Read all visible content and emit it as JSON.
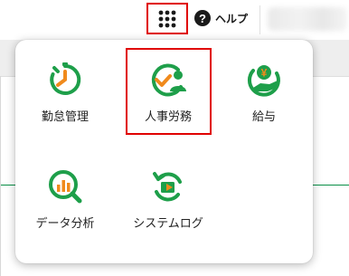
{
  "header": {
    "help_label": "ヘルプ",
    "help_glyph": "?"
  },
  "apps_menu": {
    "items": [
      {
        "label": "勤怠管理",
        "icon": "stopwatch-icon"
      },
      {
        "label": "人事労務",
        "icon": "people-check-icon"
      },
      {
        "label": "給与",
        "icon": "yen-hand-icon"
      },
      {
        "label": "データ分析",
        "icon": "chart-magnifier-icon"
      },
      {
        "label": "システムログ",
        "icon": "log-refresh-icon"
      }
    ],
    "selected_index": 1
  },
  "colors": {
    "brand_green": "#1e9f4a",
    "accent_orange": "#f08a1c",
    "highlight_red": "#e00000"
  }
}
